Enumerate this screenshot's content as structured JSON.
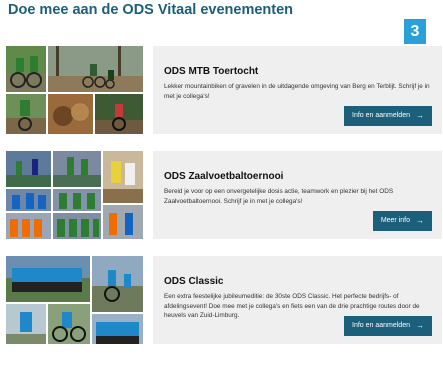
{
  "header": {
    "title": "Doe mee aan de ODS Vitaal evenementen",
    "step_badge": "3"
  },
  "events": [
    {
      "title": "ODS MTB Toertocht",
      "description": "Lekker mountainbiken of gravelen in de uitdagende omgeving van Berg en Terblijt. Schrijf je in met je collega's!",
      "button_label": "Info en aanmelden",
      "button_icon": "arrow-right-icon"
    },
    {
      "title": "ODS Zaalvoetbaltoernooi",
      "description": "Bereid je voor op een onvergetelijke dosis actie, teamwork en plezier bij het ODS Zaalvoetbaltoernooi. Schrijf je in met je collega's!",
      "button_label": "Meer info",
      "button_icon": "arrow-right-icon"
    },
    {
      "title": "ODS Classic",
      "description": "Een extra feestelijke jubileumeditie: de 30ste ODS Classic. Het perfecte bedrijfs- of afdelingsevent! Doe mee met je collega's en fiets een van de drie prachtige routes door de heuvels van Zuid-Limburg.",
      "button_label": "Info en aanmelden",
      "button_icon": "arrow-right-icon"
    }
  ],
  "colors": {
    "brand": "#1b5f7a",
    "badge": "#2aa0d8",
    "card_bg": "#efefef"
  }
}
